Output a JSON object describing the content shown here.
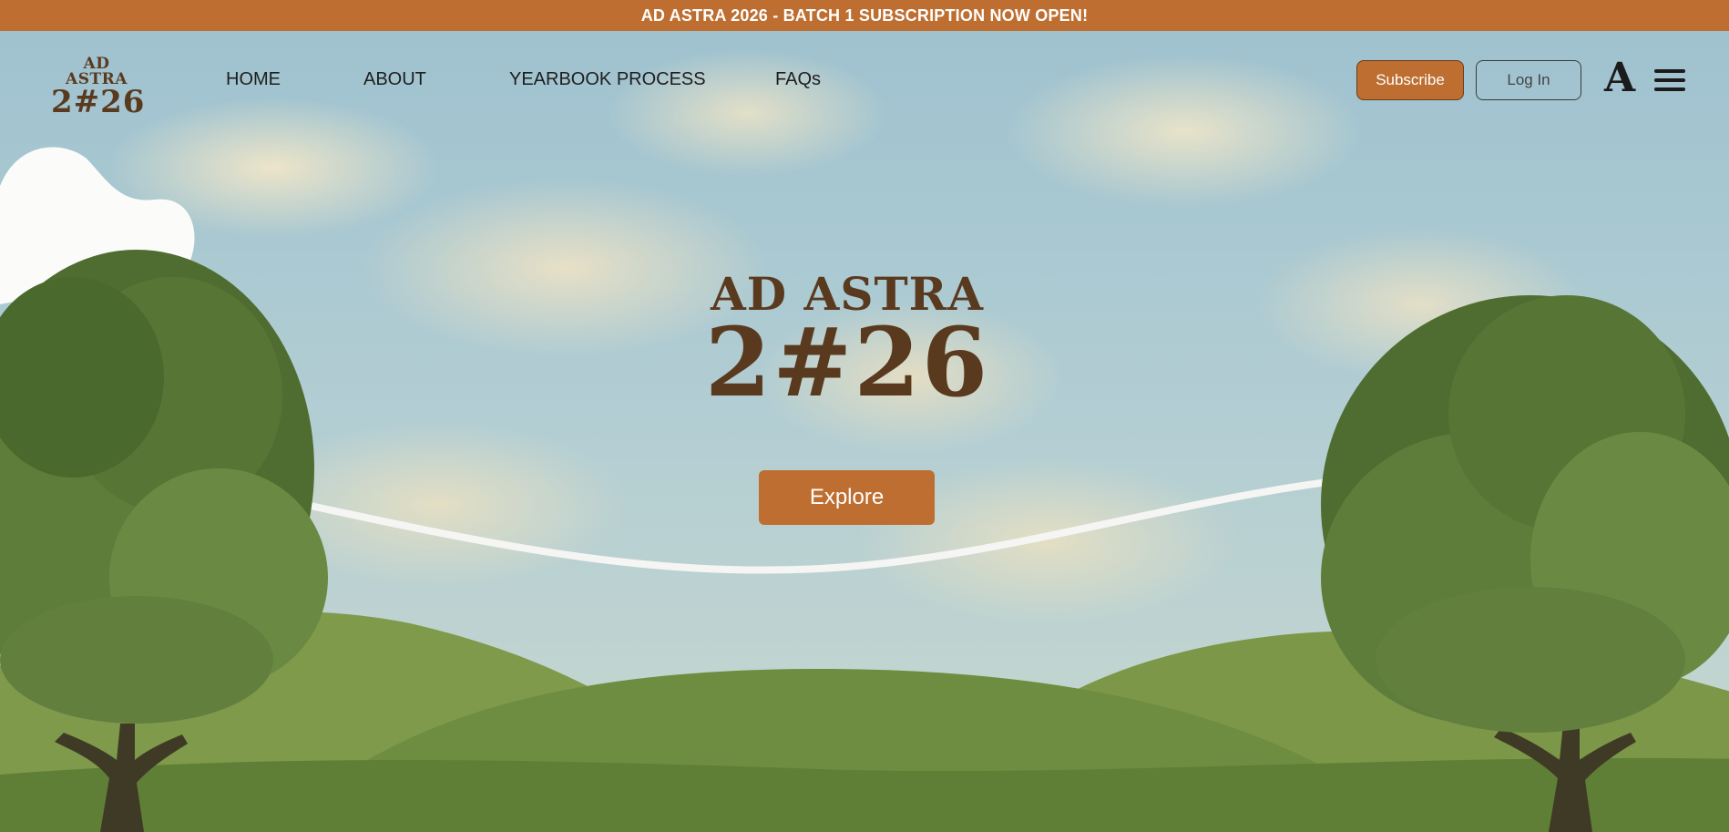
{
  "banner": {
    "text": "AD ASTRA 2026 - BATCH 1 SUBSCRIPTION NOW OPEN!"
  },
  "brand": {
    "line1": "AD ASTRA",
    "line2": "2#26"
  },
  "nav": {
    "items": [
      {
        "label": "HOME"
      },
      {
        "label": "ABOUT"
      },
      {
        "label": "YEARBOOK PROCESS"
      },
      {
        "label": "FAQs"
      }
    ]
  },
  "actions": {
    "subscribe": "Subscribe",
    "login": "Log In",
    "a_icon": "A"
  },
  "hero": {
    "logo_line1": "AD ASTRA",
    "logo_line2": "2#26",
    "explore": "Explore"
  },
  "colors": {
    "accent": "#bd6e30",
    "brand_brown": "#5a3a1f",
    "grass": "#6c8c3c"
  },
  "icons": [
    "menu-icon",
    "a-logo-icon"
  ]
}
